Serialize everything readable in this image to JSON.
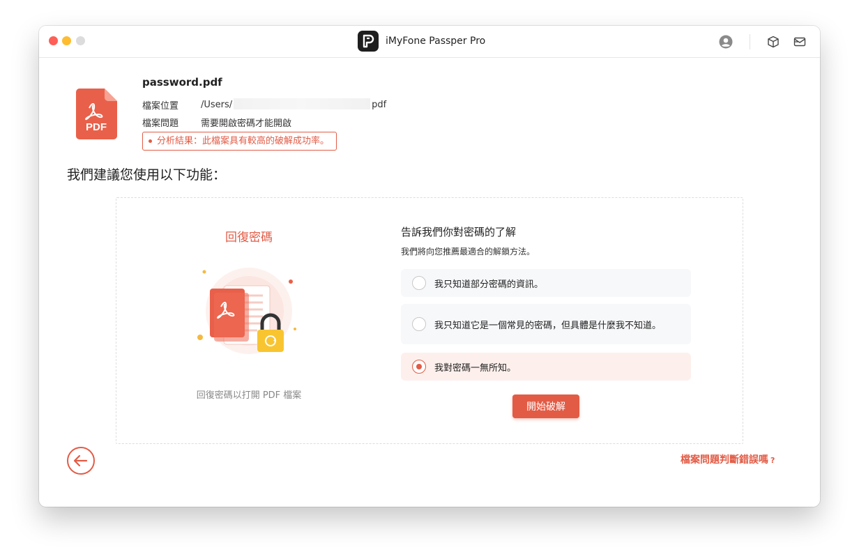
{
  "window": {
    "title": "iMyFone Passper Pro"
  },
  "file": {
    "name": "password.pdf",
    "location_label": "檔案位置",
    "location_prefix": "/Users/",
    "location_suffix": "pdf",
    "issue_label": "檔案問題",
    "issue_value": "需要開啟密碼才能開啟",
    "analysis_result": "分析結果：此檔案具有較高的破解成功率。",
    "icon_text": "PDF"
  },
  "suggest": {
    "title": "我們建議您使用以下功能："
  },
  "recover": {
    "title": "回復密碼",
    "description": "回復密碼以打開 PDF 檔案"
  },
  "question": {
    "title": "告訴我們你對密碼的了解",
    "subtitle": "我們將向您推薦最適合的解鎖方法。",
    "options": [
      {
        "label": "我只知道部分密碼的資訊。",
        "selected": false
      },
      {
        "label": "我只知道它是一個常見的密碼，但具體是什麼我不知道。",
        "selected": false
      },
      {
        "label": "我對密碼一無所知。",
        "selected": true
      }
    ],
    "start_button": "開始破解"
  },
  "footer": {
    "wrong_link": "檔案問題判斷錯誤嗎",
    "wrong_link_mark": "?"
  },
  "colors": {
    "accent": "#e25b45",
    "selected_bg": "#fdf0ec",
    "option_bg": "#f7f8fa"
  },
  "icons": [
    "app-logo-icon",
    "user-icon",
    "box-icon",
    "mail-icon",
    "pdf-file-icon",
    "back-arrow-icon",
    "lock-icon"
  ]
}
